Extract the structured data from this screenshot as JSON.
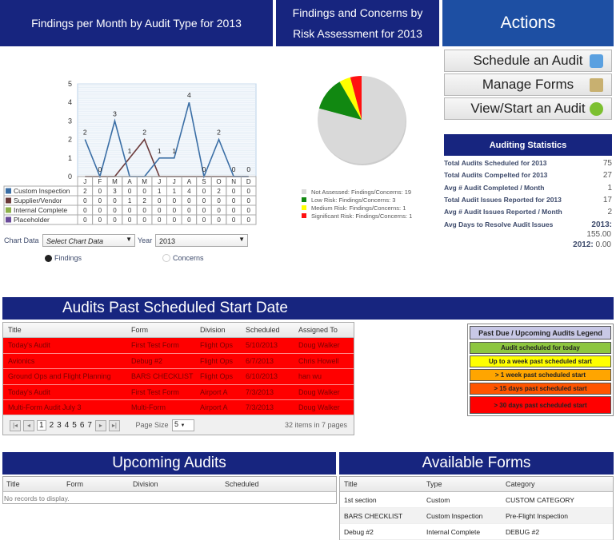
{
  "headers": {
    "findings_chart": "Findings per Month by Audit Type for 2013",
    "risk_chart": "Findings and Concerns by Risk Assessment for 2013",
    "actions": "Actions",
    "past_due": "Audits Past Scheduled Start Date",
    "upcoming": "Upcoming Audits",
    "forms": "Available Forms"
  },
  "chart_data": [
    {
      "type": "line",
      "categories": [
        "J",
        "F",
        "M",
        "A",
        "M",
        "J",
        "J",
        "A",
        "S",
        "O",
        "N",
        "D"
      ],
      "ylim": [
        0,
        5
      ],
      "yticks": [
        0,
        1,
        2,
        3,
        4,
        5
      ],
      "grid": true,
      "legend": "bottom-table",
      "series": [
        {
          "name": "Custom Inspection",
          "color": "#3a6ea5",
          "values": [
            2,
            0,
            3,
            0,
            0,
            1,
            1,
            4,
            0,
            2,
            0,
            0
          ]
        },
        {
          "name": "Supplier/Vendor",
          "color": "#6b3a3a",
          "values": [
            0,
            0,
            0,
            1,
            2,
            0,
            0,
            0,
            0,
            0,
            0,
            0
          ]
        },
        {
          "name": "Internal Complete",
          "color": "#8cb04a",
          "values": [
            0,
            0,
            0,
            0,
            0,
            0,
            0,
            0,
            0,
            0,
            0,
            0
          ]
        },
        {
          "name": "Placeholder",
          "color": "#6a4a9a",
          "values": [
            0,
            0,
            0,
            0,
            0,
            0,
            0,
            0,
            0,
            0,
            0,
            0
          ]
        }
      ]
    },
    {
      "type": "pie",
      "legend": "bottom",
      "slices": [
        {
          "name": "Not Assessed:  Findings/Concerns: 19",
          "value": 19,
          "color": "#d9d9d9"
        },
        {
          "name": "Low Risk:  Findings/Concerns: 3",
          "value": 3,
          "color": "#118811"
        },
        {
          "name": "Medium Risk:  Findings/Concerns: 1",
          "value": 1,
          "color": "#ffff00"
        },
        {
          "name": "Significant Risk:  Findings/Concerns: 1",
          "value": 1,
          "color": "#ff1111"
        }
      ]
    }
  ],
  "controls": {
    "chart_data_label": "Chart Data",
    "chart_data_value": "Select Chart Data",
    "year_label": "Year",
    "year_value": "2013",
    "radio_findings": "Findings",
    "radio_concerns": "Concerns"
  },
  "actions": [
    "Schedule an Audit",
    "Manage Forms",
    "View/Start an Audit"
  ],
  "stats": {
    "title": "Auditing Statistics",
    "rows": [
      {
        "label": "Total Audits Scheduled for 2013",
        "value": "75"
      },
      {
        "label": "Total Audits Compelted for 2013",
        "value": "27"
      },
      {
        "label": "Avg # Audit Completed / Month",
        "value": "1"
      },
      {
        "label": "Total Audit Issues Reported for 2013",
        "value": "17"
      },
      {
        "label": "Avg # Audit Issues Reported / Month",
        "value": "2"
      },
      {
        "label": "Avg Days to Resolve Audit Issues",
        "value": "2013:"
      }
    ],
    "resolve_2013": "155.00",
    "resolve_2012_label": "2012:",
    "resolve_2012": "0.00"
  },
  "past_due": {
    "columns": [
      "Title",
      "Form",
      "Division",
      "Scheduled",
      "Assigned To"
    ],
    "rows": [
      [
        "Today's Audit",
        "First Test Form",
        "Flight Ops",
        "5/10/2013",
        "Doug Walker"
      ],
      [
        "Avionics",
        "Debug #2",
        "Flight Ops",
        "6/7/2013",
        "Chris Howell"
      ],
      [
        "Ground Ops and Flight Planning",
        "BARS CHECKLIST",
        "Flight Ops",
        "6/10/2013",
        "han wu"
      ],
      [
        "Today's Audit",
        "First Test Form",
        "Airport A",
        "7/3/2013",
        "Doug Walker"
      ],
      [
        "Multi-Form Audit July 3",
        "Multi-Form",
        "Airport A",
        "7/3/2013",
        "Doug Walker"
      ]
    ],
    "pages": [
      "1",
      "2",
      "3",
      "4",
      "5",
      "6",
      "7"
    ],
    "page_size_label": "Page Size",
    "page_size": "5",
    "summary": "32 items in 7 pages"
  },
  "legend": {
    "title": "Past Due / Upcoming Audits Legend",
    "items": [
      {
        "label": "Audit scheduled for today",
        "color": "#8dc63f"
      },
      {
        "label": "Up to a week past scheduled start",
        "color": "#ffff00"
      },
      {
        "label": "> 1 week past scheduled start",
        "color": "#ffa500"
      },
      {
        "label": "> 15 days past scheduled start",
        "color": "#ff5500"
      },
      {
        "label": "> 30 days past scheduled start",
        "color": "#ff0000"
      }
    ]
  },
  "upcoming": {
    "columns": [
      "Title",
      "Form",
      "Division",
      "Scheduled"
    ],
    "empty": "No records to display."
  },
  "forms": {
    "columns": [
      "Title",
      "Type",
      "Category"
    ],
    "rows": [
      [
        "1st section",
        "Custom",
        "CUSTOM CATEGORY"
      ],
      [
        "BARS CHECKLIST",
        "Custom Inspection",
        "Pre-Flight Inspection"
      ],
      [
        "Debug #2",
        "Internal Complete",
        "DEBUG #2"
      ]
    ]
  }
}
